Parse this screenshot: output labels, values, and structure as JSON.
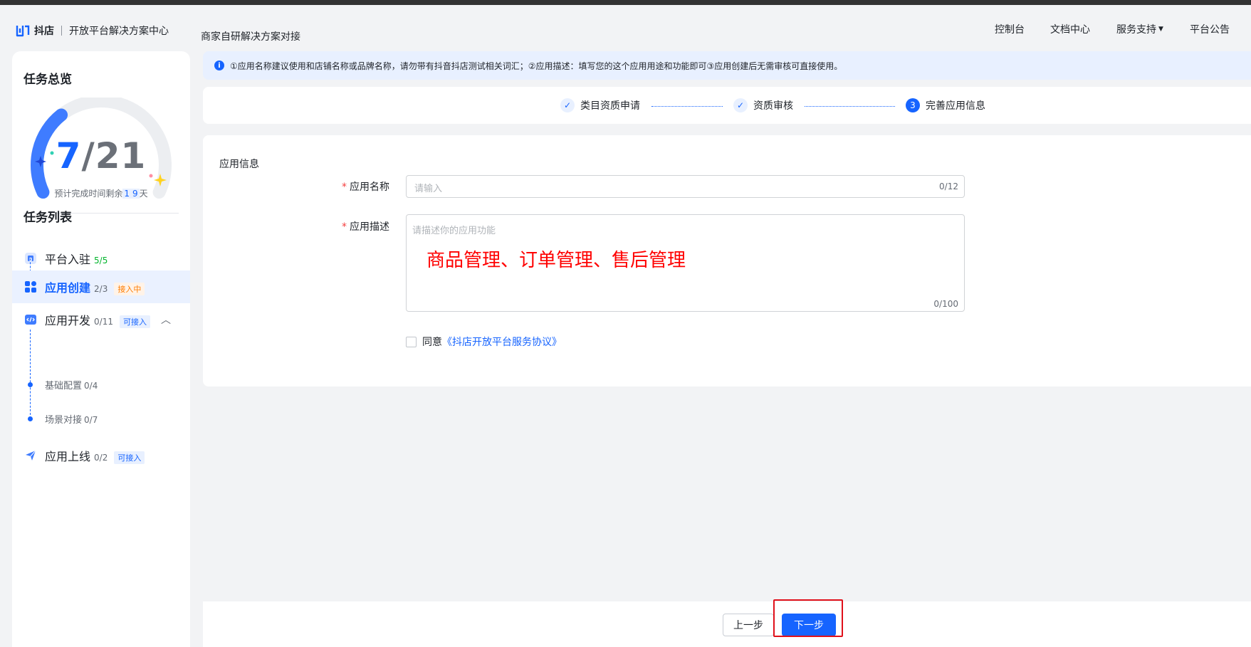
{
  "header": {
    "brand_name": "抖店",
    "brand_sub": "开放平台解决方案中心",
    "page_title": "商家自研解决方案对接",
    "nav": [
      "控制台",
      "文档中心",
      "服务支持",
      "平台公告"
    ]
  },
  "sidebar": {
    "overview_title": "任务总览",
    "progress": {
      "done": "7",
      "slash": "/",
      "total": "21",
      "fraction": 0.333
    },
    "eta_prefix": "预计完成时间剩余",
    "eta_digits": [
      "1",
      "9"
    ],
    "eta_suffix": "天",
    "list_title": "任务列表",
    "tasks": [
      {
        "name": "平台入驻",
        "count": "5/5",
        "tag": ""
      },
      {
        "name": "应用创建",
        "count": "2/3",
        "tag": "接入中"
      },
      {
        "name": "应用开发",
        "count": "0/11",
        "tag": "可接入"
      },
      {
        "name": "应用上线",
        "count": "0/2",
        "tag": "可接入"
      }
    ],
    "subtasks": [
      {
        "name": "基础配置",
        "count": "0/4"
      },
      {
        "name": "场景对接",
        "count": "0/7"
      }
    ]
  },
  "notice": {
    "icon": "info-icon",
    "text": "①应用名称建议使用和店铺名称或品牌名称，请勿带有抖音抖店测试相关词汇；②应用描述：填写您的这个应用用途和功能即可③应用创建后无需审核可直接使用。"
  },
  "steps": [
    {
      "label": "类目资质申请",
      "status": "done",
      "marker": "✓"
    },
    {
      "label": "资质审核",
      "status": "done",
      "marker": "✓"
    },
    {
      "label": "完善应用信息",
      "status": "current",
      "marker": "3"
    }
  ],
  "form": {
    "section_title": "应用信息",
    "name_label": "应用名称",
    "name_placeholder": "请输入",
    "name_count": "0/12",
    "desc_label": "应用描述",
    "desc_placeholder": "请描述你的应用功能",
    "desc_annotation": "商品管理、订单管理、售后管理",
    "desc_count": "0/100",
    "agree_text": "同意",
    "agree_link": "《抖店开放平台服务协议》"
  },
  "footer": {
    "prev_label": "上一步",
    "next_label": "下一步"
  },
  "colors": {
    "accent": "#1664ff",
    "required": "#f53f3f",
    "annotation": "#ff0000",
    "success": "#00b42a",
    "warning": "#ff7d00"
  }
}
